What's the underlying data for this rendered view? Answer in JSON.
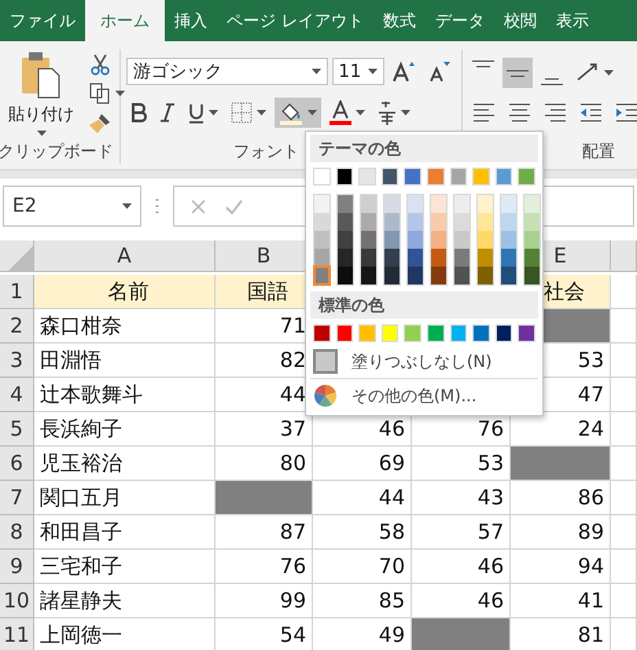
{
  "tabs": [
    {
      "label": "ファイル",
      "selected": false
    },
    {
      "label": "ホーム",
      "selected": true
    },
    {
      "label": "挿入",
      "selected": false
    },
    {
      "label": "ページ レイアウト",
      "selected": false
    },
    {
      "label": "数式",
      "selected": false
    },
    {
      "label": "データ",
      "selected": false
    },
    {
      "label": "校閲",
      "selected": false
    },
    {
      "label": "表示",
      "selected": false
    }
  ],
  "ribbon": {
    "clipboard": {
      "paste_label": "貼り付け",
      "group_label": "クリップボード"
    },
    "font": {
      "font_name": "游ゴシック",
      "font_size": "11",
      "group_label": "フォント",
      "fill_pressed": true
    },
    "alignment": {
      "group_label": "配置",
      "middle_pressed": true
    }
  },
  "name_box": "E2",
  "sheet": {
    "columns": [
      "A",
      "B",
      null,
      null,
      "E"
    ],
    "rows": [
      {
        "header": "1",
        "kind": "heading",
        "color": "#fff2cc",
        "cells": [
          {
            "text": "名前"
          },
          {
            "text": "国語"
          },
          null,
          null,
          {
            "text": "社会"
          }
        ]
      },
      {
        "header": "2",
        "kind": "data",
        "cells": [
          {
            "text": "森口柑奈"
          },
          {
            "text": "71"
          },
          null,
          null,
          {
            "color": "#808080"
          }
        ]
      },
      {
        "header": "3",
        "kind": "data",
        "cells": [
          {
            "text": "田淵悟"
          },
          {
            "text": "82"
          },
          null,
          null,
          {
            "text": "53"
          }
        ]
      },
      {
        "header": "4",
        "kind": "data",
        "cells": [
          {
            "text": "辻本歌舞斗"
          },
          {
            "text": "44"
          },
          null,
          null,
          {
            "text": "47"
          }
        ]
      },
      {
        "header": "5",
        "kind": "data",
        "cells": [
          {
            "text": "長浜絢子"
          },
          {
            "text": "37"
          },
          {
            "text": "46"
          },
          {
            "text": "76"
          },
          {
            "text": "24"
          }
        ]
      },
      {
        "header": "6",
        "kind": "data",
        "cells": [
          {
            "text": "児玉裕治"
          },
          {
            "text": "80"
          },
          {
            "text": "69"
          },
          {
            "text": "53"
          },
          {
            "color": "#808080"
          }
        ]
      },
      {
        "header": "7",
        "kind": "data",
        "cells": [
          {
            "text": "関口五月"
          },
          {
            "color": "#808080"
          },
          {
            "text": "44"
          },
          {
            "text": "43"
          },
          {
            "text": "86"
          }
        ]
      },
      {
        "header": "8",
        "kind": "data",
        "cells": [
          {
            "text": "和田昌子"
          },
          {
            "text": "87"
          },
          {
            "text": "58"
          },
          {
            "text": "57"
          },
          {
            "text": "89"
          }
        ]
      },
      {
        "header": "9",
        "kind": "data",
        "cells": [
          {
            "text": "三宅和子"
          },
          {
            "text": "76"
          },
          {
            "text": "70"
          },
          {
            "text": "46"
          },
          {
            "text": "94"
          }
        ]
      },
      {
        "header": "10",
        "kind": "data",
        "cells": [
          {
            "text": "諸星静夫"
          },
          {
            "text": "99"
          },
          {
            "text": "85"
          },
          {
            "text": "46"
          },
          {
            "text": "41"
          }
        ]
      },
      {
        "header": "11",
        "kind": "data",
        "cells": [
          {
            "text": "上岡徳一"
          },
          {
            "text": "54"
          },
          {
            "text": "49"
          },
          {
            "color": "#808080"
          },
          {
            "text": "81"
          }
        ]
      }
    ]
  },
  "color_menu": {
    "theme_title": "テーマの色",
    "theme_colors": [
      {
        "color": "#ffffff",
        "selected": false,
        "shades": [
          {
            "color": "#f2f2f2",
            "selected": false
          },
          {
            "color": "#d9d9d9",
            "selected": false
          },
          {
            "color": "#bfbfbf",
            "selected": false
          },
          {
            "color": "#a6a6a6",
            "selected": false
          },
          {
            "color": "#808080",
            "selected": true
          }
        ]
      },
      {
        "color": "#000000",
        "selected": false,
        "shades": [
          {
            "color": "#808080",
            "selected": false
          },
          {
            "color": "#595959",
            "selected": false
          },
          {
            "color": "#404040",
            "selected": false
          },
          {
            "color": "#262626",
            "selected": false
          },
          {
            "color": "#0d0d0d",
            "selected": false
          }
        ]
      },
      {
        "color": "#e7e6e6",
        "selected": false,
        "shades": [
          {
            "color": "#d0cece",
            "selected": false
          },
          {
            "color": "#aeaaaa",
            "selected": false
          },
          {
            "color": "#757171",
            "selected": false
          },
          {
            "color": "#3a3838",
            "selected": false
          },
          {
            "color": "#171616",
            "selected": false
          }
        ]
      },
      {
        "color": "#44546a",
        "selected": false,
        "shades": [
          {
            "color": "#d6dce4",
            "selected": false
          },
          {
            "color": "#adb9ca",
            "selected": false
          },
          {
            "color": "#8497b0",
            "selected": false
          },
          {
            "color": "#333f4f",
            "selected": false
          },
          {
            "color": "#222b35",
            "selected": false
          }
        ]
      },
      {
        "color": "#4472c4",
        "selected": false,
        "shades": [
          {
            "color": "#d9e1f2",
            "selected": false
          },
          {
            "color": "#b4c6e7",
            "selected": false
          },
          {
            "color": "#8ea9db",
            "selected": false
          },
          {
            "color": "#305496",
            "selected": false
          },
          {
            "color": "#203764",
            "selected": false
          }
        ]
      },
      {
        "color": "#ed7d31",
        "selected": false,
        "shades": [
          {
            "color": "#fce4d6",
            "selected": false
          },
          {
            "color": "#f8cbad",
            "selected": false
          },
          {
            "color": "#f4b084",
            "selected": false
          },
          {
            "color": "#c65911",
            "selected": false
          },
          {
            "color": "#833c0c",
            "selected": false
          }
        ]
      },
      {
        "color": "#a5a5a5",
        "selected": false,
        "shades": [
          {
            "color": "#ededed",
            "selected": false
          },
          {
            "color": "#dbdbdb",
            "selected": false
          },
          {
            "color": "#c9c9c9",
            "selected": false
          },
          {
            "color": "#7b7b7b",
            "selected": false
          },
          {
            "color": "#525252",
            "selected": false
          }
        ]
      },
      {
        "color": "#ffc000",
        "selected": false,
        "shades": [
          {
            "color": "#fff2cc",
            "selected": false
          },
          {
            "color": "#ffe699",
            "selected": false
          },
          {
            "color": "#ffd966",
            "selected": false
          },
          {
            "color": "#bf8f00",
            "selected": false
          },
          {
            "color": "#806000",
            "selected": false
          }
        ]
      },
      {
        "color": "#5b9bd5",
        "selected": false,
        "shades": [
          {
            "color": "#ddebf7",
            "selected": false
          },
          {
            "color": "#bdd7ee",
            "selected": false
          },
          {
            "color": "#9bc2e6",
            "selected": false
          },
          {
            "color": "#2f75b5",
            "selected": false
          },
          {
            "color": "#1f4e78",
            "selected": false
          }
        ]
      },
      {
        "color": "#70ad47",
        "selected": false,
        "shades": [
          {
            "color": "#e2efda",
            "selected": false
          },
          {
            "color": "#c6e0b4",
            "selected": false
          },
          {
            "color": "#a9d08e",
            "selected": false
          },
          {
            "color": "#548235",
            "selected": false
          },
          {
            "color": "#375623",
            "selected": false
          }
        ]
      }
    ],
    "standard_title": "標準の色",
    "standard_colors": [
      {
        "color": "#c00000",
        "selected": false
      },
      {
        "color": "#ff0000",
        "selected": false
      },
      {
        "color": "#ffc000",
        "selected": false
      },
      {
        "color": "#ffff00",
        "selected": false
      },
      {
        "color": "#92d050",
        "selected": false
      },
      {
        "color": "#00b050",
        "selected": false
      },
      {
        "color": "#00b0f0",
        "selected": false
      },
      {
        "color": "#0070c0",
        "selected": false
      },
      {
        "color": "#002060",
        "selected": false
      },
      {
        "color": "#7030a0",
        "selected": false
      }
    ],
    "no_fill": "塗りつぶしなし(N)",
    "more_colors": "その他の色(M)..."
  }
}
